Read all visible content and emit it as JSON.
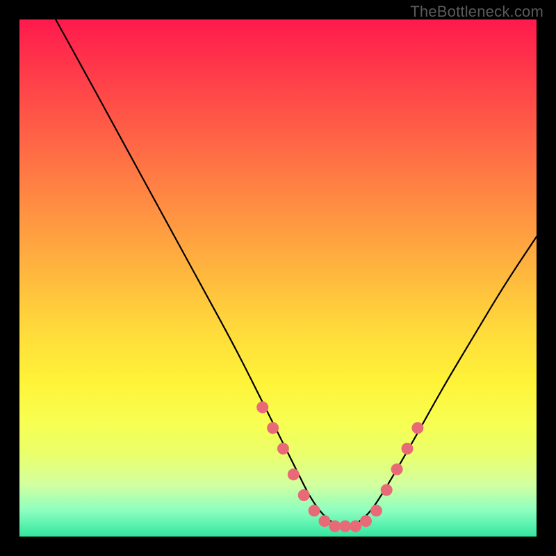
{
  "watermark": "TheBottleneck.com",
  "chart_data": {
    "type": "line",
    "title": "",
    "xlabel": "",
    "ylabel": "",
    "xlim": [
      0,
      100
    ],
    "ylim": [
      0,
      100
    ],
    "series": [
      {
        "name": "curve",
        "x": [
          7,
          12,
          18,
          24,
          30,
          36,
          42,
          47,
          51,
          54,
          56,
          58,
          60,
          62,
          64,
          66,
          68,
          70,
          73,
          77,
          82,
          88,
          94,
          100
        ],
        "y": [
          100,
          91,
          80,
          69,
          58,
          47,
          36,
          26,
          18,
          12,
          8,
          5,
          3,
          2,
          2,
          3,
          5,
          8,
          13,
          20,
          29,
          39,
          49,
          58
        ]
      }
    ],
    "markers": [
      {
        "x": 47,
        "y": 25
      },
      {
        "x": 49,
        "y": 21
      },
      {
        "x": 51,
        "y": 17
      },
      {
        "x": 53,
        "y": 12
      },
      {
        "x": 55,
        "y": 8
      },
      {
        "x": 57,
        "y": 5
      },
      {
        "x": 59,
        "y": 3
      },
      {
        "x": 61,
        "y": 2
      },
      {
        "x": 63,
        "y": 2
      },
      {
        "x": 65,
        "y": 2
      },
      {
        "x": 67,
        "y": 3
      },
      {
        "x": 69,
        "y": 5
      },
      {
        "x": 71,
        "y": 9
      },
      {
        "x": 73,
        "y": 13
      },
      {
        "x": 75,
        "y": 17
      },
      {
        "x": 77,
        "y": 21
      }
    ],
    "marker_color": "#e96a77",
    "curve_color": "#000000",
    "gradient_stops": [
      {
        "pos": 0,
        "color": "#ff1a4d"
      },
      {
        "pos": 50,
        "color": "#ffda3b"
      },
      {
        "pos": 100,
        "color": "#32e6a0"
      }
    ]
  }
}
